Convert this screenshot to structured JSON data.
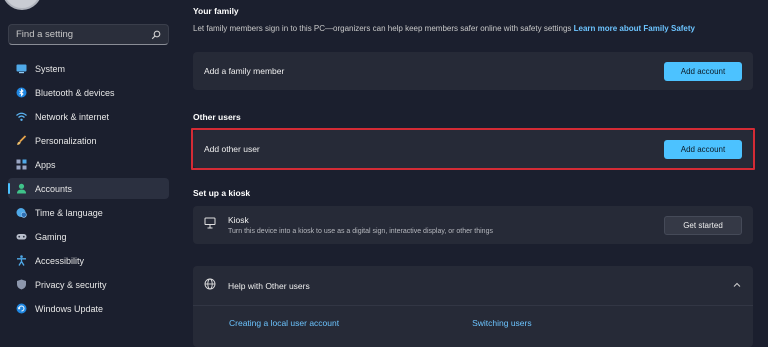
{
  "sidebar": {
    "search_placeholder": "Find a setting",
    "items": [
      {
        "label": "System",
        "icon": "monitor-icon",
        "active": false
      },
      {
        "label": "Bluetooth & devices",
        "icon": "bluetooth-icon",
        "active": false
      },
      {
        "label": "Network & internet",
        "icon": "wifi-icon",
        "active": false
      },
      {
        "label": "Personalization",
        "icon": "brush-icon",
        "active": false
      },
      {
        "label": "Apps",
        "icon": "apps-icon",
        "active": false
      },
      {
        "label": "Accounts",
        "icon": "person-icon",
        "active": true
      },
      {
        "label": "Time & language",
        "icon": "globe-clock-icon",
        "active": false
      },
      {
        "label": "Gaming",
        "icon": "gamepad-icon",
        "active": false
      },
      {
        "label": "Accessibility",
        "icon": "accessibility-icon",
        "active": false
      },
      {
        "label": "Privacy & security",
        "icon": "shield-icon",
        "active": false
      },
      {
        "label": "Windows Update",
        "icon": "update-icon",
        "active": false
      }
    ]
  },
  "family": {
    "title": "Your family",
    "description": "Let family members sign in to this PC—organizers can help keep members safer online with safety settings",
    "link": "Learn more about Family Safety",
    "add_member_label": "Add a family member",
    "add_account_button": "Add account"
  },
  "other_users": {
    "title": "Other users",
    "add_other_label": "Add other user",
    "add_account_button": "Add account"
  },
  "kiosk": {
    "title": "Set up a kiosk",
    "card_title": "Kiosk",
    "card_subtitle": "Turn this device into a kiosk to use as a digital sign, interactive display, or other things",
    "button": "Get started"
  },
  "help": {
    "title": "Help with Other users",
    "links": [
      "Creating a local user account",
      "Switching users"
    ]
  },
  "colors": {
    "accent": "#4cc2ff",
    "highlight": "#d42b35",
    "background": "#1b1f2e",
    "card": "#262a37"
  }
}
